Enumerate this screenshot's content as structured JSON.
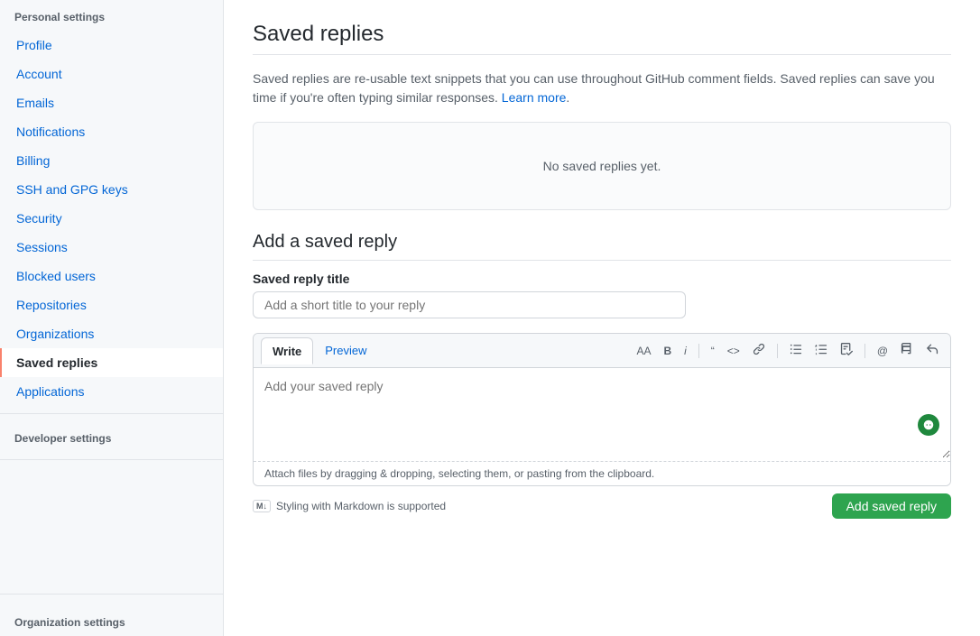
{
  "sidebar": {
    "personal_settings_label": "Personal settings",
    "items": [
      {
        "id": "profile",
        "label": "Profile",
        "active": false
      },
      {
        "id": "account",
        "label": "Account",
        "active": false
      },
      {
        "id": "emails",
        "label": "Emails",
        "active": false
      },
      {
        "id": "notifications",
        "label": "Notifications",
        "active": false
      },
      {
        "id": "billing",
        "label": "Billing",
        "active": false
      },
      {
        "id": "ssh-gpg-keys",
        "label": "SSH and GPG keys",
        "active": false
      },
      {
        "id": "security",
        "label": "Security",
        "active": false
      },
      {
        "id": "sessions",
        "label": "Sessions",
        "active": false
      },
      {
        "id": "blocked-users",
        "label": "Blocked users",
        "active": false
      },
      {
        "id": "repositories",
        "label": "Repositories",
        "active": false
      },
      {
        "id": "organizations",
        "label": "Organizations",
        "active": false
      },
      {
        "id": "saved-replies",
        "label": "Saved replies",
        "active": true
      },
      {
        "id": "applications",
        "label": "Applications",
        "active": false
      }
    ],
    "developer_settings_label": "Developer settings",
    "org_settings_label": "Organization settings"
  },
  "main": {
    "title": "Saved replies",
    "description": "Saved replies are re-usable text snippets that you can use throughout GitHub comment fields. Saved replies can save you time if you're often typing similar responses.",
    "learn_more_label": "Learn more",
    "empty_message": "No saved replies yet.",
    "add_section_title": "Add a saved reply",
    "form": {
      "title_label": "Saved reply title",
      "title_placeholder": "Add a short title to your reply",
      "write_tab": "Write",
      "preview_tab": "Preview",
      "textarea_placeholder": "Add your saved reply",
      "attach_message": "Attach files by dragging & dropping, selecting them, or pasting from the clipboard.",
      "markdown_note": "Styling with Markdown is supported",
      "add_button_label": "Add saved reply"
    },
    "toolbar_icons": {
      "aa": "AA",
      "bold": "B",
      "italic": "i",
      "quote": "❝",
      "code": "<>",
      "link": "🔗",
      "unordered_list": "≡",
      "ordered_list": "≡#",
      "task_list": "☑",
      "mention": "@",
      "reference": "🔖",
      "reply": "↩"
    }
  }
}
